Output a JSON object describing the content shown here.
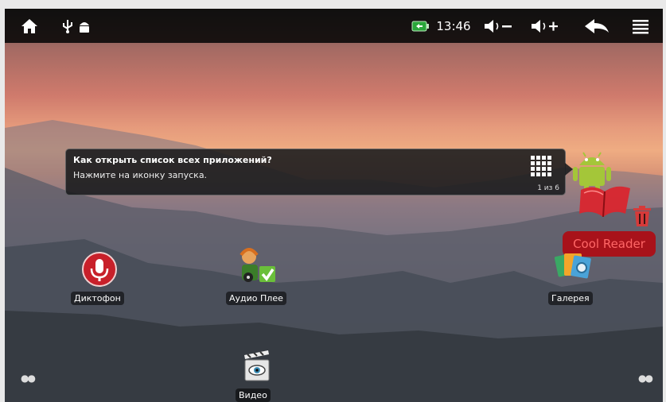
{
  "status_bar": {
    "time": "13:46",
    "icons": [
      "home-icon",
      "usb-icon",
      "android-debug-icon",
      "battery-icon",
      "volume-down-icon",
      "volume-up-icon",
      "back-icon",
      "menu-icon"
    ]
  },
  "tooltip": {
    "title": "Как открыть список всех приложений?",
    "text": "Нажмите на иконку запуска.",
    "counter": "1 из 6"
  },
  "apps": [
    {
      "label": "Диктофон",
      "icon": "microphone-icon"
    },
    {
      "label": "Аудио Плее",
      "icon": "audio-player-icon"
    },
    {
      "label": "Галерея",
      "icon": "gallery-icon"
    },
    {
      "label": "Видео",
      "icon": "video-clapper-icon"
    }
  ],
  "drag_item": {
    "label": "Cool Reader",
    "icon": "book-icon",
    "drop_target": "trash-icon"
  },
  "colors": {
    "status_bar": "#0a0a0a",
    "drag_label_bg": "#a8121a",
    "drag_label_text": "#ff6666",
    "android_green": "#a4c639",
    "mic_red": "#c8202a"
  }
}
